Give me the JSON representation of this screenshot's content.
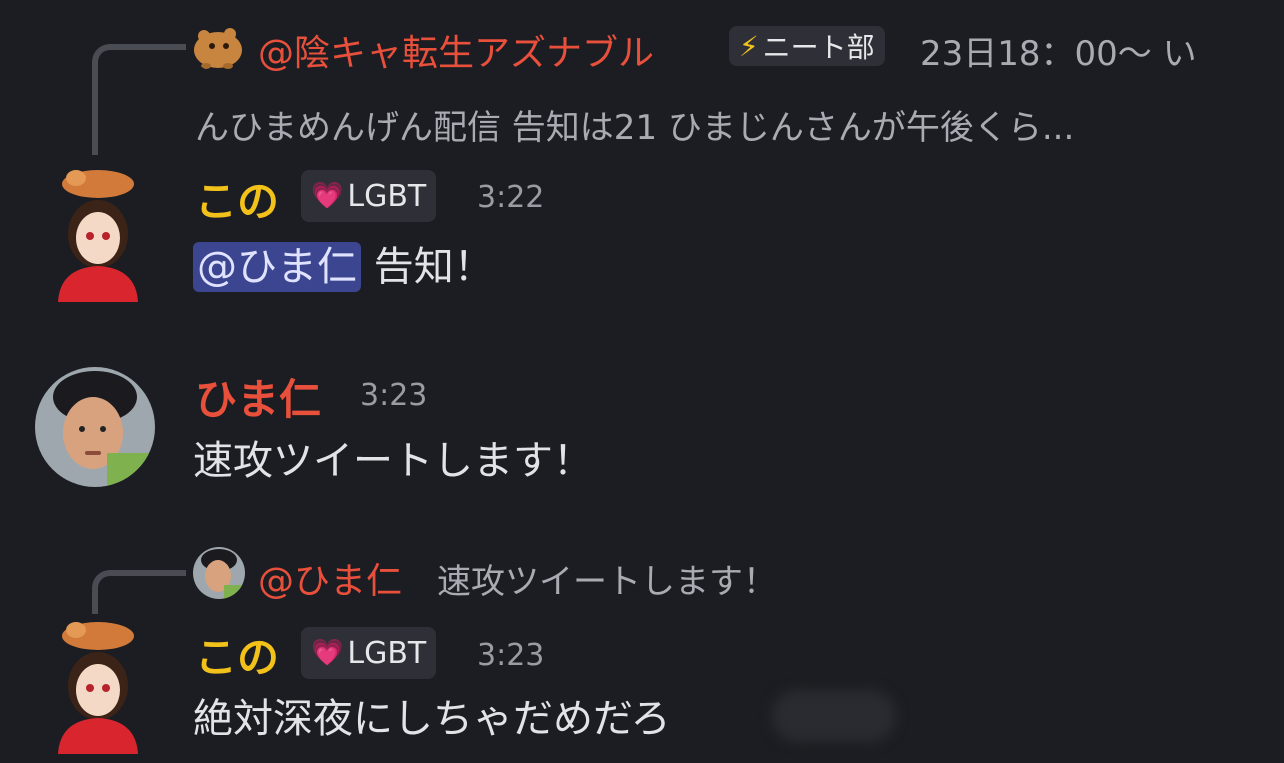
{
  "colors": {
    "background": "#1c1d22",
    "name_red": "#e8503c",
    "name_yellow": "#f3c21a",
    "mention_bg": "#3c4590",
    "muted": "#a9abb2"
  },
  "messages": [
    {
      "reply": {
        "author": "@陰キャ転生アズナブル",
        "badge_icon": "⚡",
        "badge": "ニート部",
        "text_line1": "23日18：00〜 い",
        "text_line2": "んひまめんげん配信 告知は21 ひまじんさんが午後くら..."
      },
      "author": "この",
      "badge_icon": "💗",
      "badge": "LGBT",
      "time": "3:22",
      "mention": "@ひま仁",
      "text": " 告知！"
    },
    {
      "author": "ひま仁",
      "time": "3:23",
      "text": "速攻ツイートします！"
    },
    {
      "reply": {
        "author": "@ひま仁",
        "text": "速攻ツイートします！"
      },
      "author": "この",
      "badge_icon": "💗",
      "badge": "LGBT",
      "time": "3:23",
      "text": "絶対深夜にしちゃだめだろ"
    }
  ]
}
